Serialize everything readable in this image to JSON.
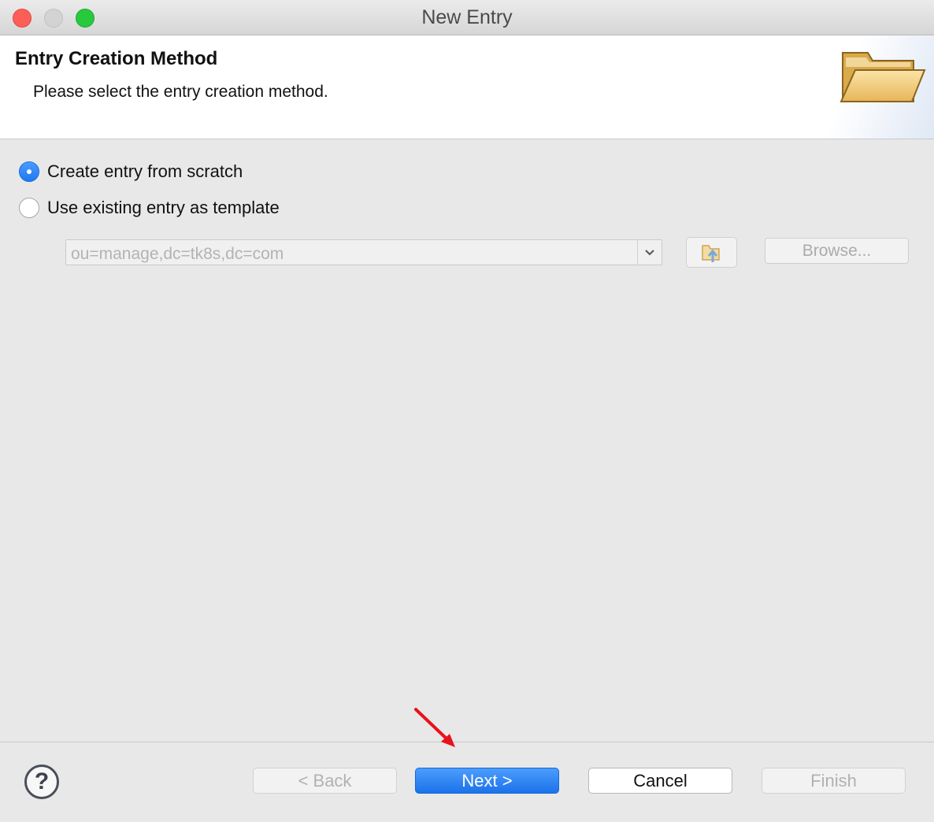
{
  "window": {
    "title": "New Entry"
  },
  "header": {
    "title": "Entry Creation Method",
    "description": "Please select the entry creation method.",
    "icon": "open-folder-icon"
  },
  "options": [
    {
      "label": "Create entry from scratch",
      "selected": true
    },
    {
      "label": "Use existing entry as template",
      "selected": false
    }
  ],
  "template": {
    "value": "ou=manage,dc=tk8s,dc=com",
    "browse_label": "Browse...",
    "enabled": false
  },
  "footer": {
    "back_label": "< Back",
    "next_label": "Next >",
    "cancel_label": "Cancel",
    "finish_label": "Finish"
  },
  "colors": {
    "accent": "#1f78f0",
    "annotation": "#e8121b"
  }
}
